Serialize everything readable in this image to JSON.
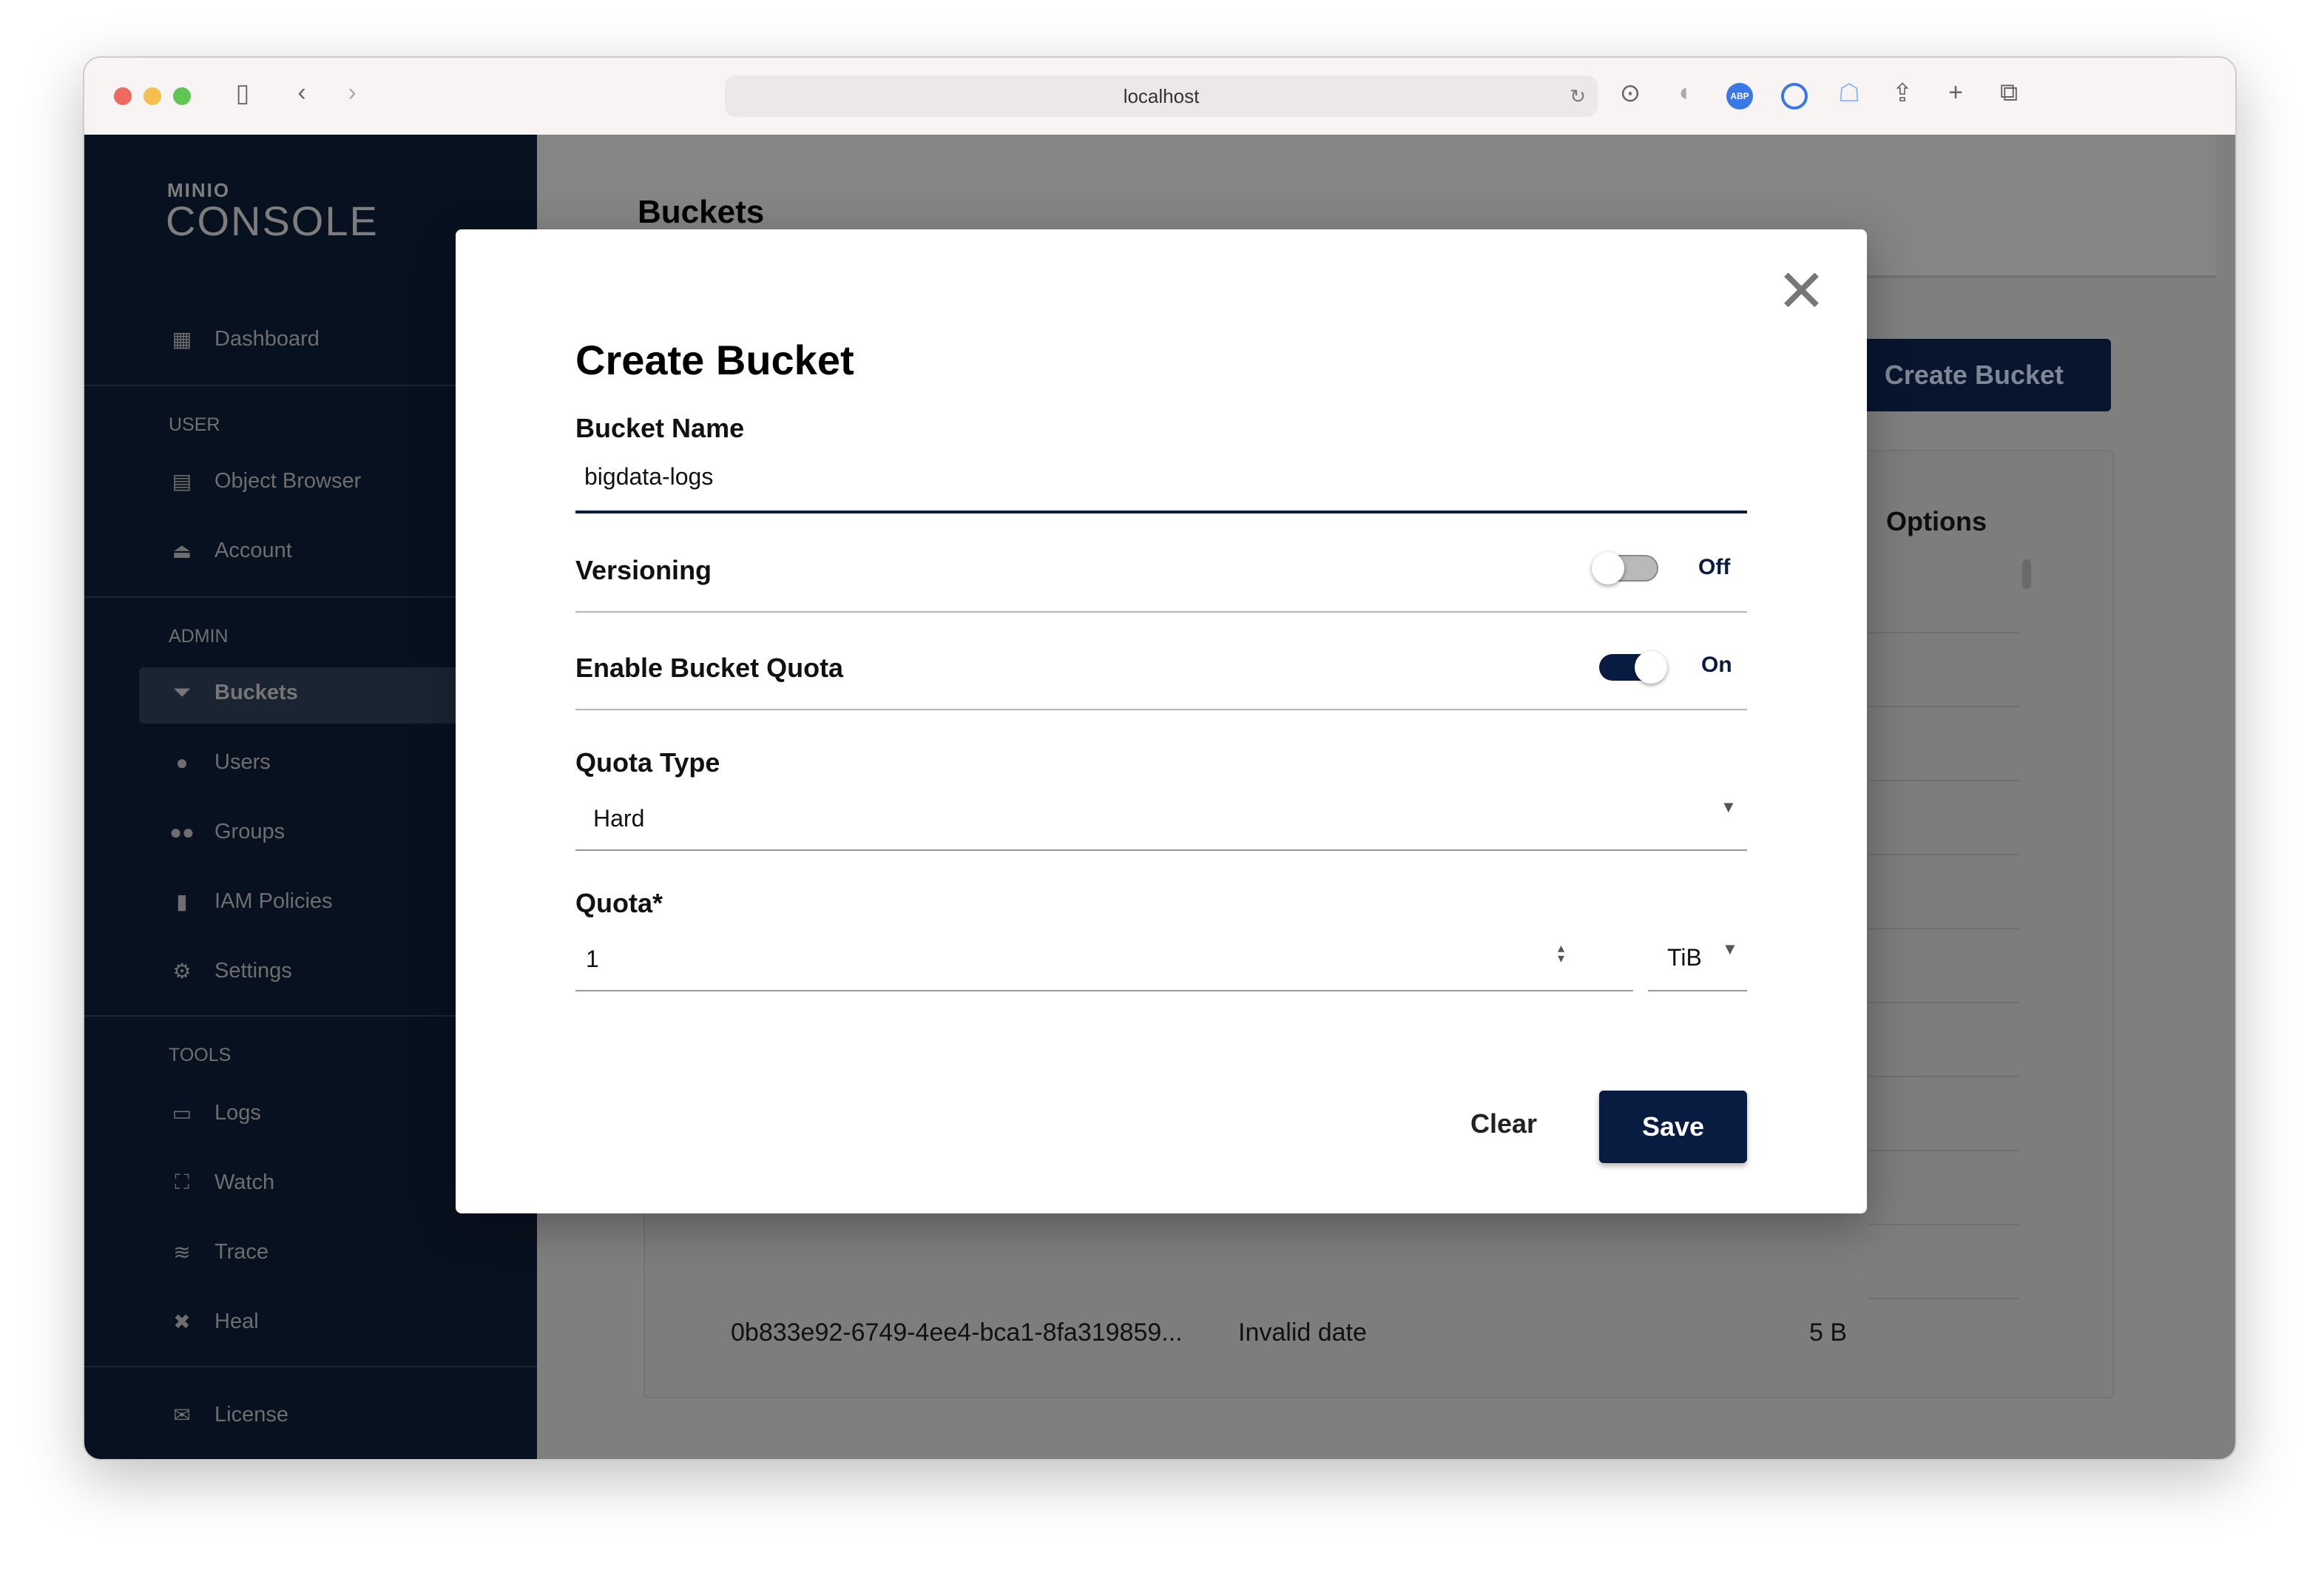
{
  "browser": {
    "url": "localhost"
  },
  "sidebar": {
    "logo_top": "MINIO",
    "logo_bottom": "CONSOLE",
    "items": [
      {
        "label": "Dashboard",
        "icon": "dashboard-icon"
      },
      {
        "section": "USER"
      },
      {
        "label": "Object Browser",
        "icon": "document-icon"
      },
      {
        "label": "Account",
        "icon": "bell-icon"
      },
      {
        "section": "ADMIN"
      },
      {
        "label": "Buckets",
        "icon": "bucket-icon",
        "active": true
      },
      {
        "label": "Users",
        "icon": "user-icon"
      },
      {
        "label": "Groups",
        "icon": "group-icon"
      },
      {
        "label": "IAM Policies",
        "icon": "bookmark-icon"
      },
      {
        "label": "Settings",
        "icon": "settings-icon"
      },
      {
        "section": "TOOLS"
      },
      {
        "label": "Logs",
        "icon": "logs-icon"
      },
      {
        "label": "Watch",
        "icon": "watch-icon"
      },
      {
        "label": "Trace",
        "icon": "trace-icon"
      },
      {
        "label": "Heal",
        "icon": "heal-icon"
      },
      {
        "label": "License",
        "icon": "license-icon"
      }
    ]
  },
  "page": {
    "title": "Buckets",
    "create_button": "Create Bucket",
    "options_header": "Options",
    "last_row": {
      "name": "0b833e92-6749-4ee4-bca1-8fa319859...",
      "date": "Invalid date",
      "size": "5 B"
    }
  },
  "modal": {
    "title": "Create Bucket",
    "bucket_name_label": "Bucket Name",
    "bucket_name_value": "bigdata-logs",
    "versioning_label": "Versioning",
    "versioning_state": "Off",
    "versioning_on": false,
    "quota_label": "Enable Bucket Quota",
    "quota_state": "On",
    "quota_on": true,
    "quota_type_label": "Quota Type",
    "quota_type_value": "Hard",
    "quota_amount_label": "Quota*",
    "quota_amount_value": "1",
    "quota_unit": "TiB",
    "clear_label": "Clear",
    "save_label": "Save"
  },
  "colors": {
    "primary": "#081c42",
    "sidebar": "#081c42"
  }
}
